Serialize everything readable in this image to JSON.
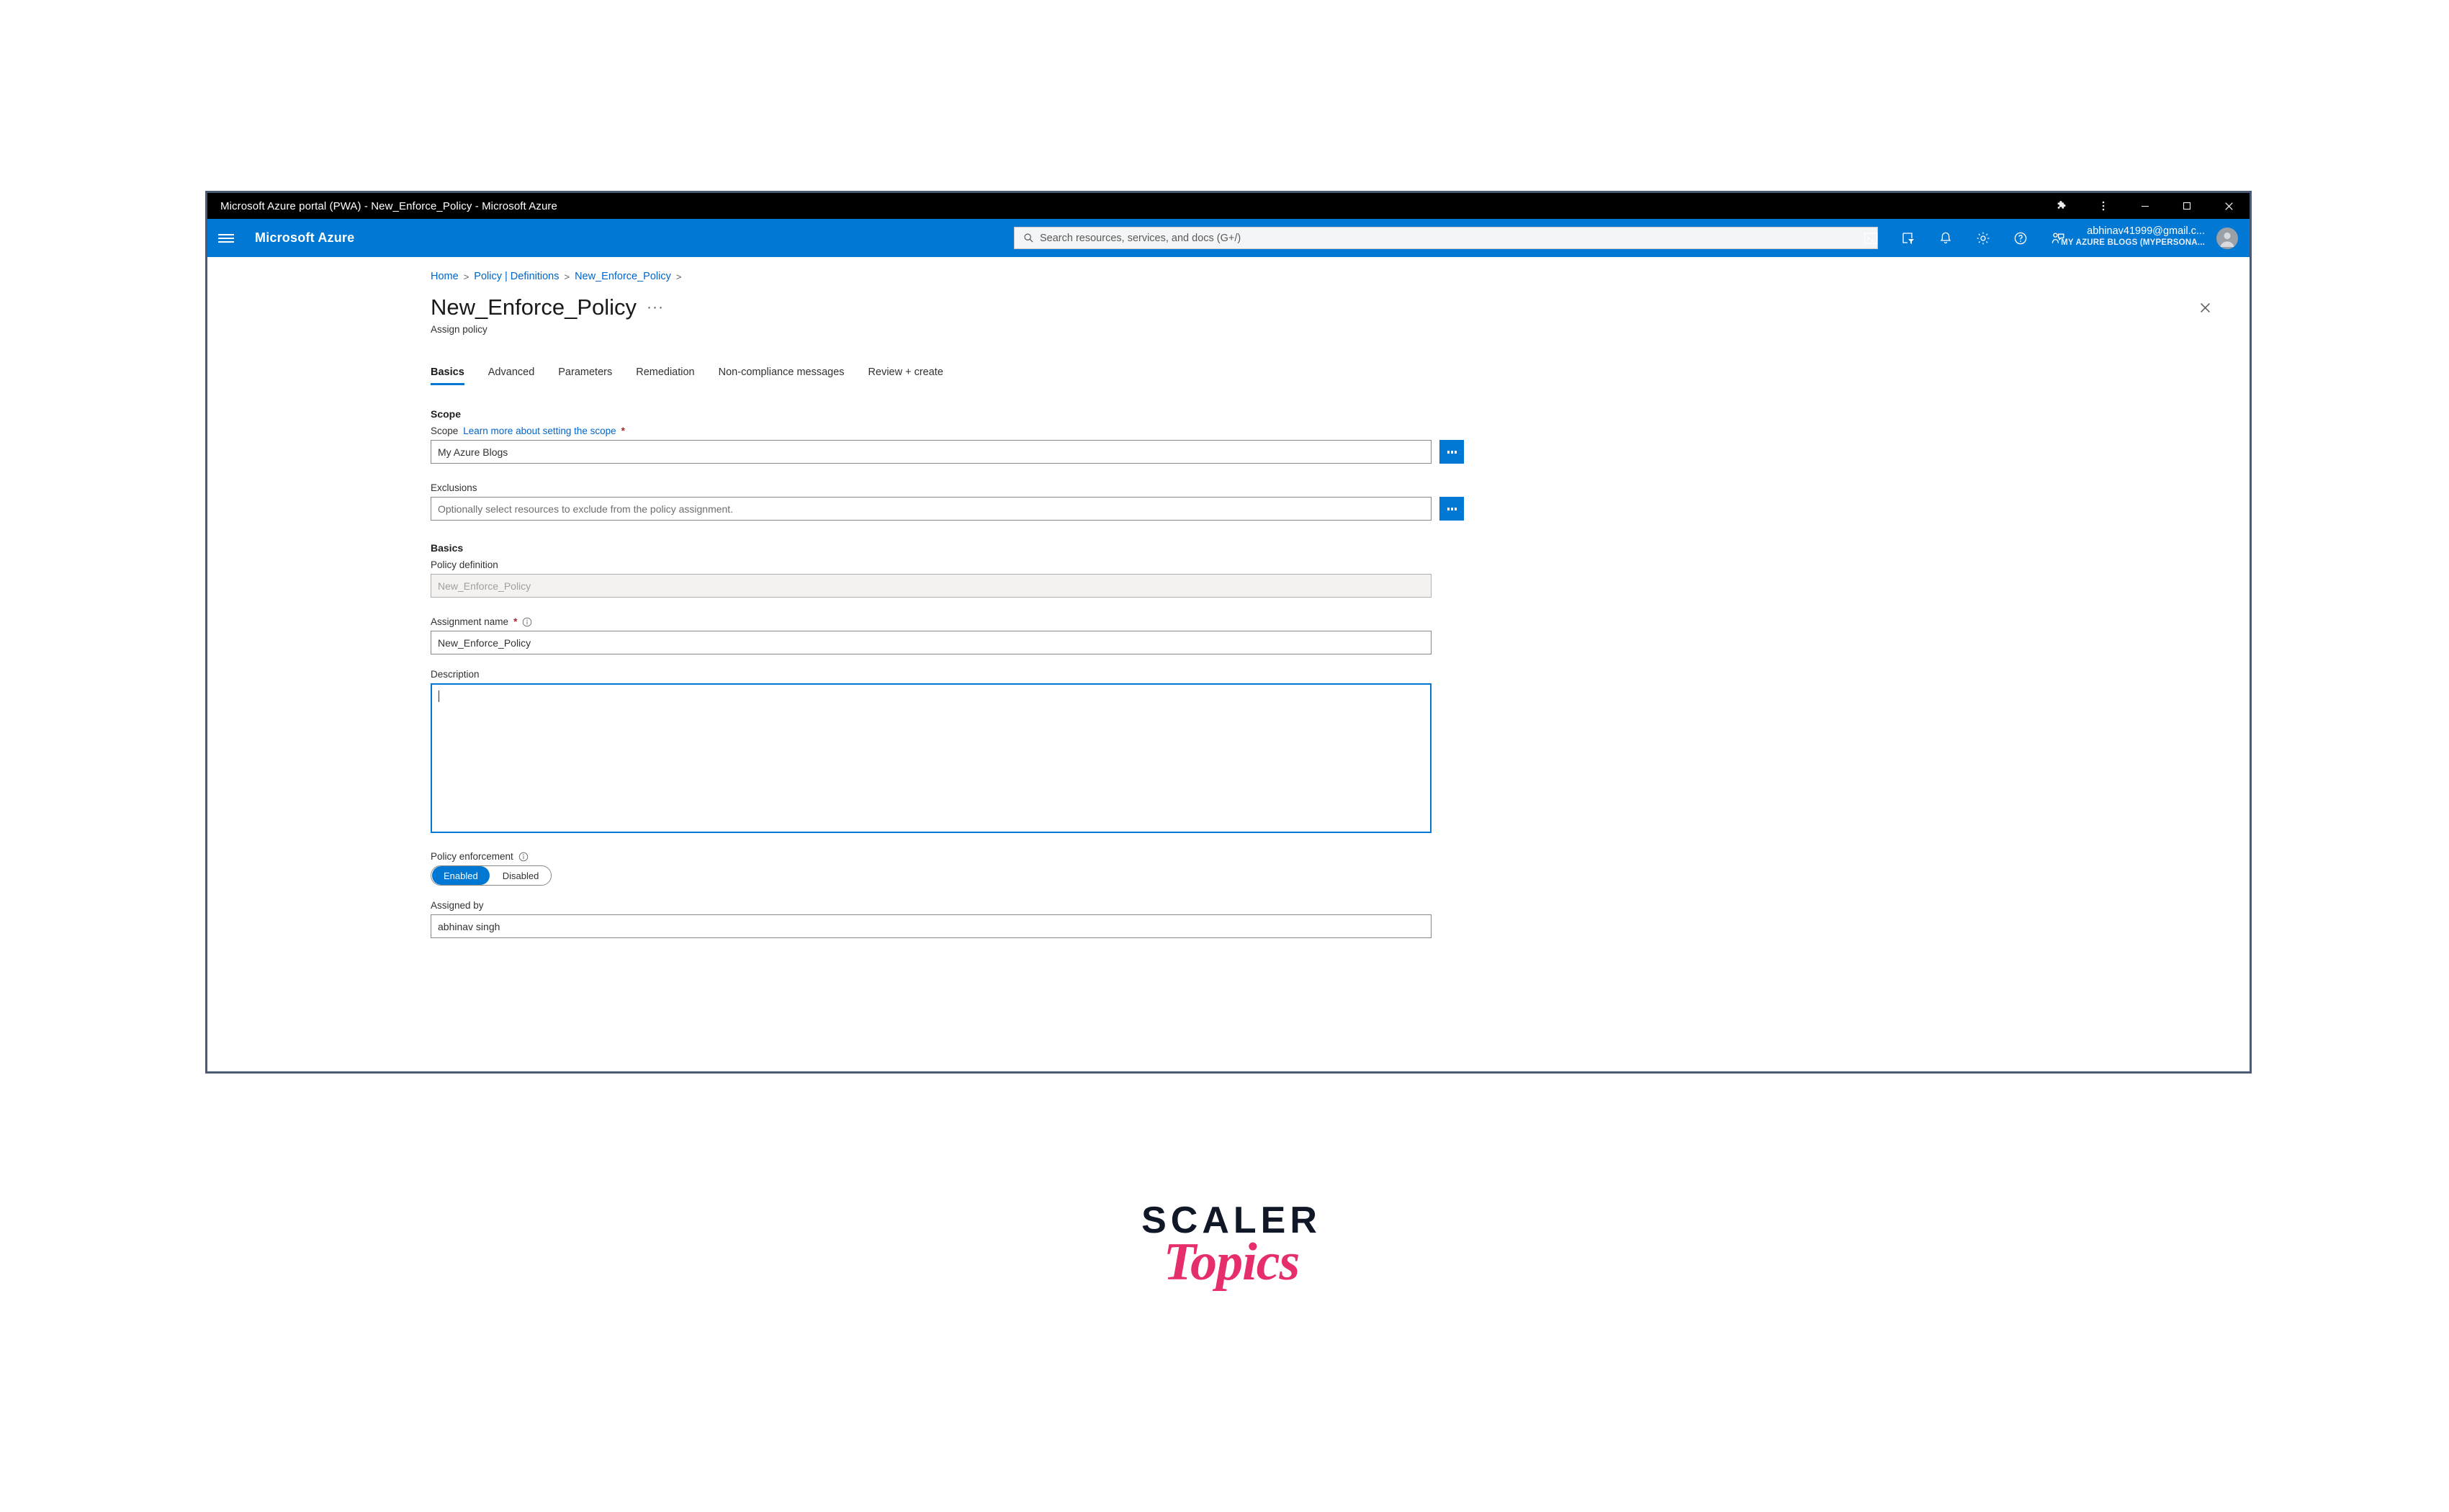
{
  "window": {
    "title": "Microsoft Azure portal (PWA) - New_Enforce_Policy - Microsoft Azure",
    "controls": {
      "extensions": "extensions-icon",
      "more": "more-options-icon",
      "minimize": "minimize-icon",
      "maximize": "maximize-icon",
      "close": "close-icon"
    }
  },
  "topbar": {
    "brand": "Microsoft Azure",
    "menu_icon": "hamburger-menu-icon",
    "search": {
      "placeholder": "Search resources, services, and docs (G+/)",
      "value": ""
    },
    "icons": [
      {
        "name": "cloud-shell-icon",
        "label": "Cloud Shell"
      },
      {
        "name": "directories-subscriptions-icon",
        "label": "Directories + subscriptions"
      },
      {
        "name": "notifications-bell-icon",
        "label": "Notifications"
      },
      {
        "name": "settings-gear-icon",
        "label": "Settings"
      },
      {
        "name": "help-question-icon",
        "label": "Help"
      },
      {
        "name": "feedback-icon",
        "label": "Feedback"
      }
    ],
    "account": {
      "email": "abhinav41999@gmail.c...",
      "directory": "MY AZURE BLOGS (MYPERSONA..."
    }
  },
  "blade": {
    "breadcrumb": [
      "Home",
      "Policy | Definitions",
      "New_Enforce_Policy"
    ],
    "breadcrumb_separator": ">",
    "title": "New_Enforce_Policy",
    "title_more": "···",
    "subtitle": "Assign policy",
    "close_label": "Close"
  },
  "tabs": [
    {
      "label": "Basics",
      "active": true
    },
    {
      "label": "Advanced",
      "active": false
    },
    {
      "label": "Parameters",
      "active": false
    },
    {
      "label": "Remediation",
      "active": false
    },
    {
      "label": "Non-compliance messages",
      "active": false
    },
    {
      "label": "Review + create",
      "active": false
    }
  ],
  "form": {
    "scope_section": {
      "heading": "Scope",
      "scope_label": "Scope",
      "scope_link": "Learn more about setting the scope",
      "required_mark": "*",
      "scope_value": "My Azure Blogs",
      "scope_picker": "...",
      "exclusions_label": "Exclusions",
      "exclusions_value": "",
      "exclusions_placeholder": "Optionally select resources to exclude from the policy assignment.",
      "exclusions_picker": "..."
    },
    "basics_section": {
      "heading": "Basics",
      "policy_definition_label": "Policy definition",
      "policy_definition_value": "New_Enforce_Policy",
      "assignment_name_label": "Assignment name",
      "assignment_name_required": "*",
      "assignment_name_value": "New_Enforce_Policy",
      "description_label": "Description",
      "description_value": "",
      "policy_enforcement_label": "Policy enforcement",
      "policy_enforcement_options": [
        "Enabled",
        "Disabled"
      ],
      "policy_enforcement_selected": "Enabled",
      "assigned_by_label": "Assigned by",
      "assigned_by_value": "abhinav singh"
    }
  },
  "watermark": {
    "line1": "SCALER",
    "line2": "Topics"
  },
  "colors": {
    "azure_blue": "#0078d4",
    "link_blue": "#0066cc",
    "required_red": "#a4262c",
    "pink": "#e62e6b",
    "navy": "#101828"
  }
}
